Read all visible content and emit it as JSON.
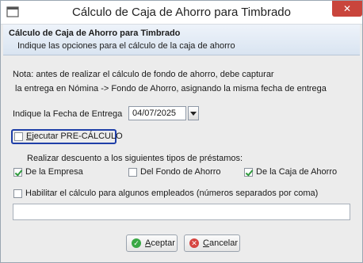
{
  "window": {
    "title": "Cálculo de Caja de Ahorro para Timbrado",
    "close_symbol": "✕",
    "icon": "app-window-icon"
  },
  "header": {
    "title": "Cálculo de Caja de Ahorro para Timbrado",
    "subtitle": "Indique las opciones para el cálculo de la caja de ahorro"
  },
  "note": {
    "line1": "Nota: antes de realizar el cálculo de fondo de ahorro, debe capturar",
    "line2": "la entrega en Nómina -> Fondo de Ahorro, asignando la misma fecha de entrega"
  },
  "date": {
    "label": "Indique la Fecha de Entrega",
    "value": "04/07/2025"
  },
  "pre_calculo": {
    "label": "Ejecutar PRE-CÁLCULO",
    "checked": false
  },
  "descuento": {
    "label": "Realizar descuento a los siguientes tipos de préstamos:",
    "options": [
      {
        "label": "De la Empresa",
        "checked": true
      },
      {
        "label": "Del Fondo de Ahorro",
        "checked": false
      },
      {
        "label": "De la Caja de Ahorro",
        "checked": true
      }
    ]
  },
  "habilitar": {
    "label": "Habilitar el cálculo para algunos empleados (números separados por coma)",
    "checked": false,
    "value": ""
  },
  "buttons": {
    "accept": "Aceptar",
    "cancel": "Cancelar",
    "accept_icon": "✓",
    "cancel_icon": "✕"
  }
}
